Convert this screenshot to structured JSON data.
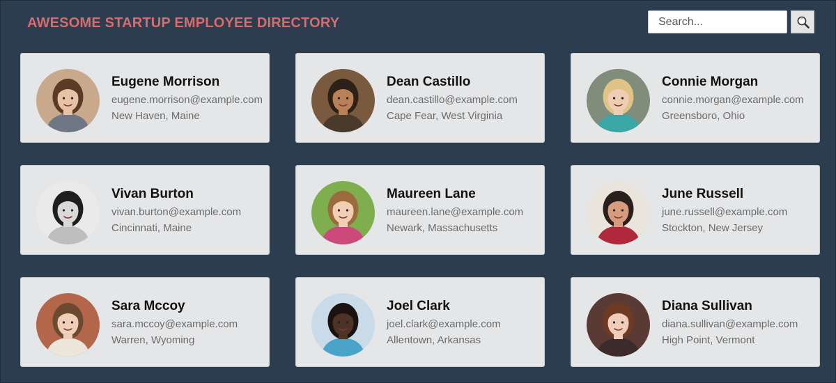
{
  "header": {
    "title": "AWESOME STARTUP EMPLOYEE DIRECTORY",
    "search_placeholder": "Search...",
    "search_value": "",
    "search_icon": "magnifier-icon"
  },
  "colors": {
    "background": "#2b3d4e",
    "title": "#d76c6c",
    "card": "#e5e6e8"
  },
  "employees": [
    {
      "name": "Eugene Morrison",
      "email": "eugene.morrison@example.com",
      "location": "New Haven, Maine",
      "photo": {
        "bg": "#c9a98c",
        "hair": "#5b3a26",
        "skin": "#e8c2a4",
        "shirt": "#6f7784"
      }
    },
    {
      "name": "Dean Castillo",
      "email": "dean.castillo@example.com",
      "location": "Cape Fear, West Virginia",
      "photo": {
        "bg": "#7a5a3e",
        "hair": "#2c2018",
        "skin": "#b98157",
        "shirt": "#4a3a2c"
      }
    },
    {
      "name": "Connie Morgan",
      "email": "connie.morgan@example.com",
      "location": "Greensboro, Ohio",
      "photo": {
        "bg": "#7f8d7a",
        "hair": "#e0c487",
        "skin": "#efcdb4",
        "shirt": "#3aa6a6"
      }
    },
    {
      "name": "Vivan Burton",
      "email": "vivan.burton@example.com",
      "location": "Cincinnati, Maine",
      "photo": {
        "bg": "#eaeaea",
        "hair": "#1e1e1e",
        "skin": "#d9d9d9",
        "shirt": "#bdbdbd"
      }
    },
    {
      "name": "Maureen Lane",
      "email": "maureen.lane@example.com",
      "location": "Newark, Massachusetts",
      "photo": {
        "bg": "#7fae4e",
        "hair": "#9b6b3d",
        "skin": "#f0cfb5",
        "shirt": "#cc4a7b"
      }
    },
    {
      "name": "June Russell",
      "email": "june.russell@example.com",
      "location": "Stockton, New Jersey",
      "photo": {
        "bg": "#e9e4dc",
        "hair": "#2a1f1a",
        "skin": "#d99b7e",
        "shirt": "#b0283c"
      }
    },
    {
      "name": "Sara Mccoy",
      "email": "sara.mccoy@example.com",
      "location": "Warren, Wyoming",
      "photo": {
        "bg": "#b4664a",
        "hair": "#6b4a2f",
        "skin": "#efcfb8",
        "shirt": "#ede6da"
      }
    },
    {
      "name": "Joel Clark",
      "email": "joel.clark@example.com",
      "location": "Allentown, Arkansas",
      "photo": {
        "bg": "#c9dbe8",
        "hair": "#1a120e",
        "skin": "#4d3226",
        "shirt": "#4aa3c8"
      }
    },
    {
      "name": "Diana Sullivan",
      "email": "diana.sullivan@example.com",
      "location": "High Point, Vermont",
      "photo": {
        "bg": "#5a3a34",
        "hair": "#6e3a22",
        "skin": "#f0cdbb",
        "shirt": "#3b2b2b"
      }
    }
  ]
}
